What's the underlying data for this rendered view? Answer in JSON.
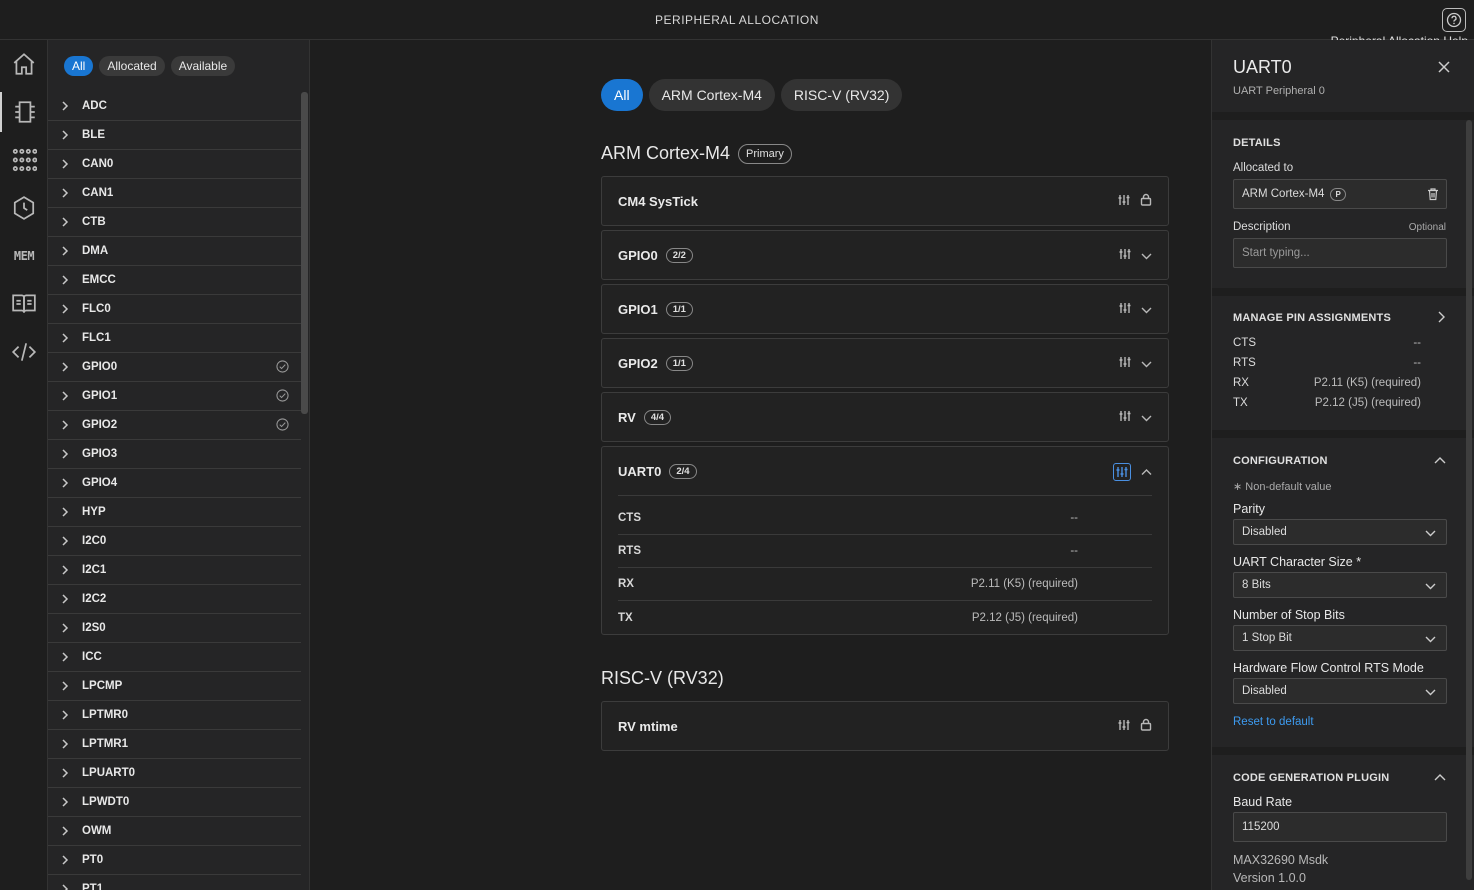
{
  "app": {
    "title": "PERIPHERAL ALLOCATION",
    "help_tooltip": "Peripheral Allocation Help"
  },
  "activity_bar": {
    "items": [
      {
        "name": "home-icon"
      },
      {
        "name": "peripheral-icon"
      },
      {
        "name": "pin-grid-icon"
      },
      {
        "name": "clock-icon"
      },
      {
        "name": "memory-icon",
        "label": "MEM"
      },
      {
        "name": "book-icon"
      },
      {
        "name": "code-icon"
      }
    ]
  },
  "sidebar": {
    "filters": [
      "All",
      "Allocated",
      "Available"
    ],
    "active_filter": "All",
    "peripherals": [
      {
        "name": "ADC"
      },
      {
        "name": "BLE"
      },
      {
        "name": "CAN0"
      },
      {
        "name": "CAN1"
      },
      {
        "name": "CTB"
      },
      {
        "name": "DMA"
      },
      {
        "name": "EMCC"
      },
      {
        "name": "FLC0"
      },
      {
        "name": "FLC1"
      },
      {
        "name": "GPIO0",
        "allocated": true
      },
      {
        "name": "GPIO1",
        "allocated": true
      },
      {
        "name": "GPIO2",
        "allocated": true
      },
      {
        "name": "GPIO3"
      },
      {
        "name": "GPIO4"
      },
      {
        "name": "HYP"
      },
      {
        "name": "I2C0"
      },
      {
        "name": "I2C1"
      },
      {
        "name": "I2C2"
      },
      {
        "name": "I2S0"
      },
      {
        "name": "ICC"
      },
      {
        "name": "LPCMP"
      },
      {
        "name": "LPTMR0"
      },
      {
        "name": "LPTMR1"
      },
      {
        "name": "LPUART0"
      },
      {
        "name": "LPWDT0"
      },
      {
        "name": "OWM"
      },
      {
        "name": "PT0"
      },
      {
        "name": "PT1"
      }
    ]
  },
  "main": {
    "core_tabs": [
      "All",
      "ARM Cortex-M4",
      "RISC-V (RV32)"
    ],
    "active_tab": "All",
    "arm_section": {
      "title": "ARM Cortex-M4",
      "badge": "Primary"
    },
    "arm_cards": [
      {
        "name": "CM4 SysTick",
        "locked": true
      },
      {
        "name": "GPIO0",
        "count": "2/2"
      },
      {
        "name": "GPIO1",
        "count": "1/1"
      },
      {
        "name": "GPIO2",
        "count": "1/1"
      },
      {
        "name": "RV",
        "count": "4/4"
      },
      {
        "name": "UART0",
        "count": "2/4",
        "expanded": true,
        "pins": [
          {
            "pin": "CTS",
            "value": "--"
          },
          {
            "pin": "RTS",
            "value": "--"
          },
          {
            "pin": "RX",
            "value": "P2.11 (K5) (required)"
          },
          {
            "pin": "TX",
            "value": "P2.12 (J5) (required)"
          }
        ]
      }
    ],
    "riscv_section": {
      "title": "RISC-V (RV32)"
    },
    "riscv_cards": [
      {
        "name": "RV mtime",
        "locked": true
      }
    ]
  },
  "details": {
    "title": "UART0",
    "subtitle": "UART Peripheral 0",
    "details_head": "DETAILS",
    "allocated_label": "Allocated to",
    "allocated_value": "ARM Cortex-M4",
    "allocated_badge": "P",
    "description_label": "Description",
    "description_optional": "Optional",
    "description_placeholder": "Start typing...",
    "pins_head": "MANAGE PIN ASSIGNMENTS",
    "pins": [
      {
        "pin": "CTS",
        "value": "--"
      },
      {
        "pin": "RTS",
        "value": "--"
      },
      {
        "pin": "RX",
        "value": "P2.11 (K5) (required)"
      },
      {
        "pin": "TX",
        "value": "P2.12 (J5) (required)"
      }
    ],
    "config_head": "CONFIGURATION",
    "non_default_note": "∗ Non-default value",
    "config": [
      {
        "label": "Parity",
        "value": "Disabled"
      },
      {
        "label": "UART Character Size *",
        "value": "8 Bits"
      },
      {
        "label": "Number of Stop Bits",
        "value": "1 Stop Bit"
      },
      {
        "label": "Hardware Flow Control RTS Mode",
        "value": "Disabled"
      }
    ],
    "reset_link": "Reset to default",
    "codegen_head": "CODE GENERATION PLUGIN",
    "baud_label": "Baud Rate",
    "baud_value": "115200",
    "plugin_name": "MAX32690 Msdk",
    "plugin_version": "Version 1.0.0"
  }
}
